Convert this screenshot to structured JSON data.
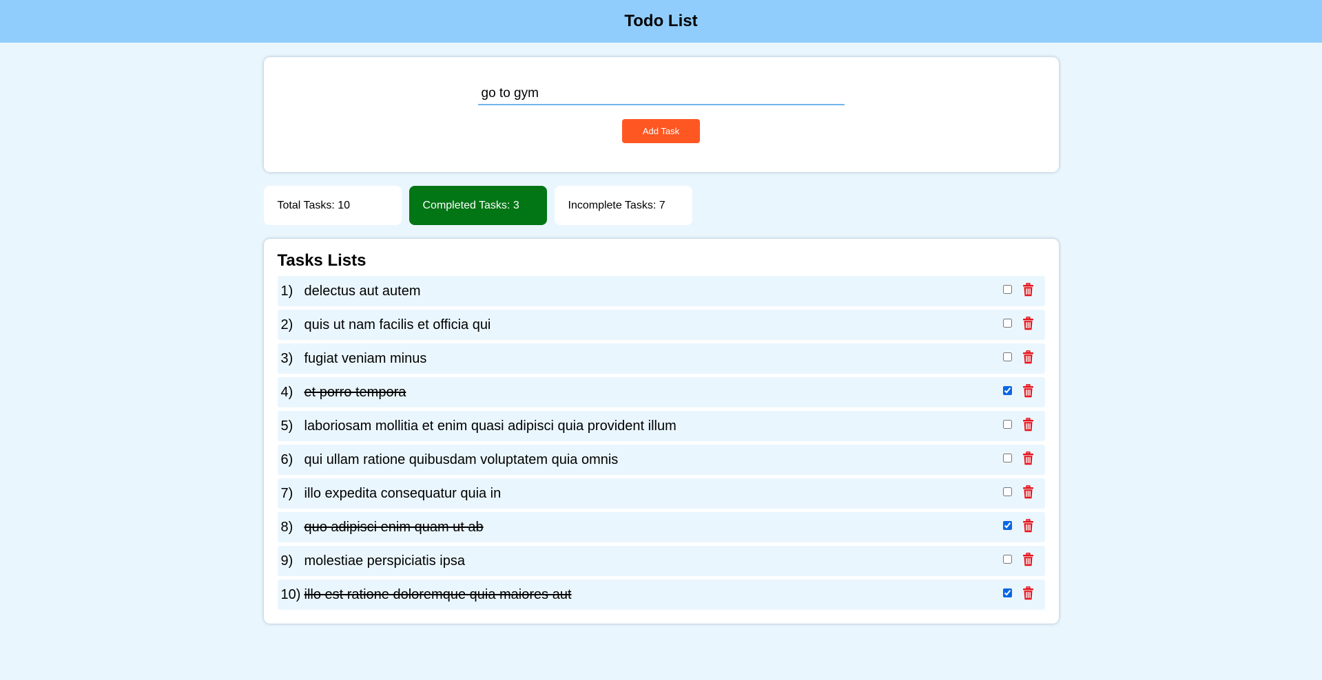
{
  "header": {
    "title": "Todo List"
  },
  "add_task": {
    "input_value": "go to gym",
    "button_label": "Add Task"
  },
  "stats": {
    "total": "Total Tasks: 10",
    "completed": "Completed Tasks: 3",
    "incomplete": "Incomplete Tasks: 7"
  },
  "tasks_section": {
    "title": "Tasks Lists"
  },
  "tasks": [
    {
      "num": "1)",
      "text": "delectus aut autem",
      "done": false
    },
    {
      "num": "2)",
      "text": "quis ut nam facilis et officia qui",
      "done": false
    },
    {
      "num": "3)",
      "text": "fugiat veniam minus",
      "done": false
    },
    {
      "num": "4)",
      "text": "et porro tempora",
      "done": true
    },
    {
      "num": "5)",
      "text": "laboriosam mollitia et enim quasi adipisci quia provident illum",
      "done": false
    },
    {
      "num": "6)",
      "text": "qui ullam ratione quibusdam voluptatem quia omnis",
      "done": false
    },
    {
      "num": "7)",
      "text": "illo expedita consequatur quia in",
      "done": false
    },
    {
      "num": "8)",
      "text": "quo adipisci enim quam ut ab",
      "done": true
    },
    {
      "num": "9)",
      "text": "molestiae perspiciatis ipsa",
      "done": false
    },
    {
      "num": "10)",
      "text": "illo est ratione doloremque quia maiores aut",
      "done": true
    }
  ],
  "colors": {
    "header_bg": "#90cdfc",
    "page_bg": "#eaf6fd",
    "add_button": "#ff5722",
    "completed_badge": "#027515",
    "delete_icon": "#e8141c",
    "checkbox": "#0b66e4"
  },
  "icons": {
    "delete": "trash-icon"
  }
}
